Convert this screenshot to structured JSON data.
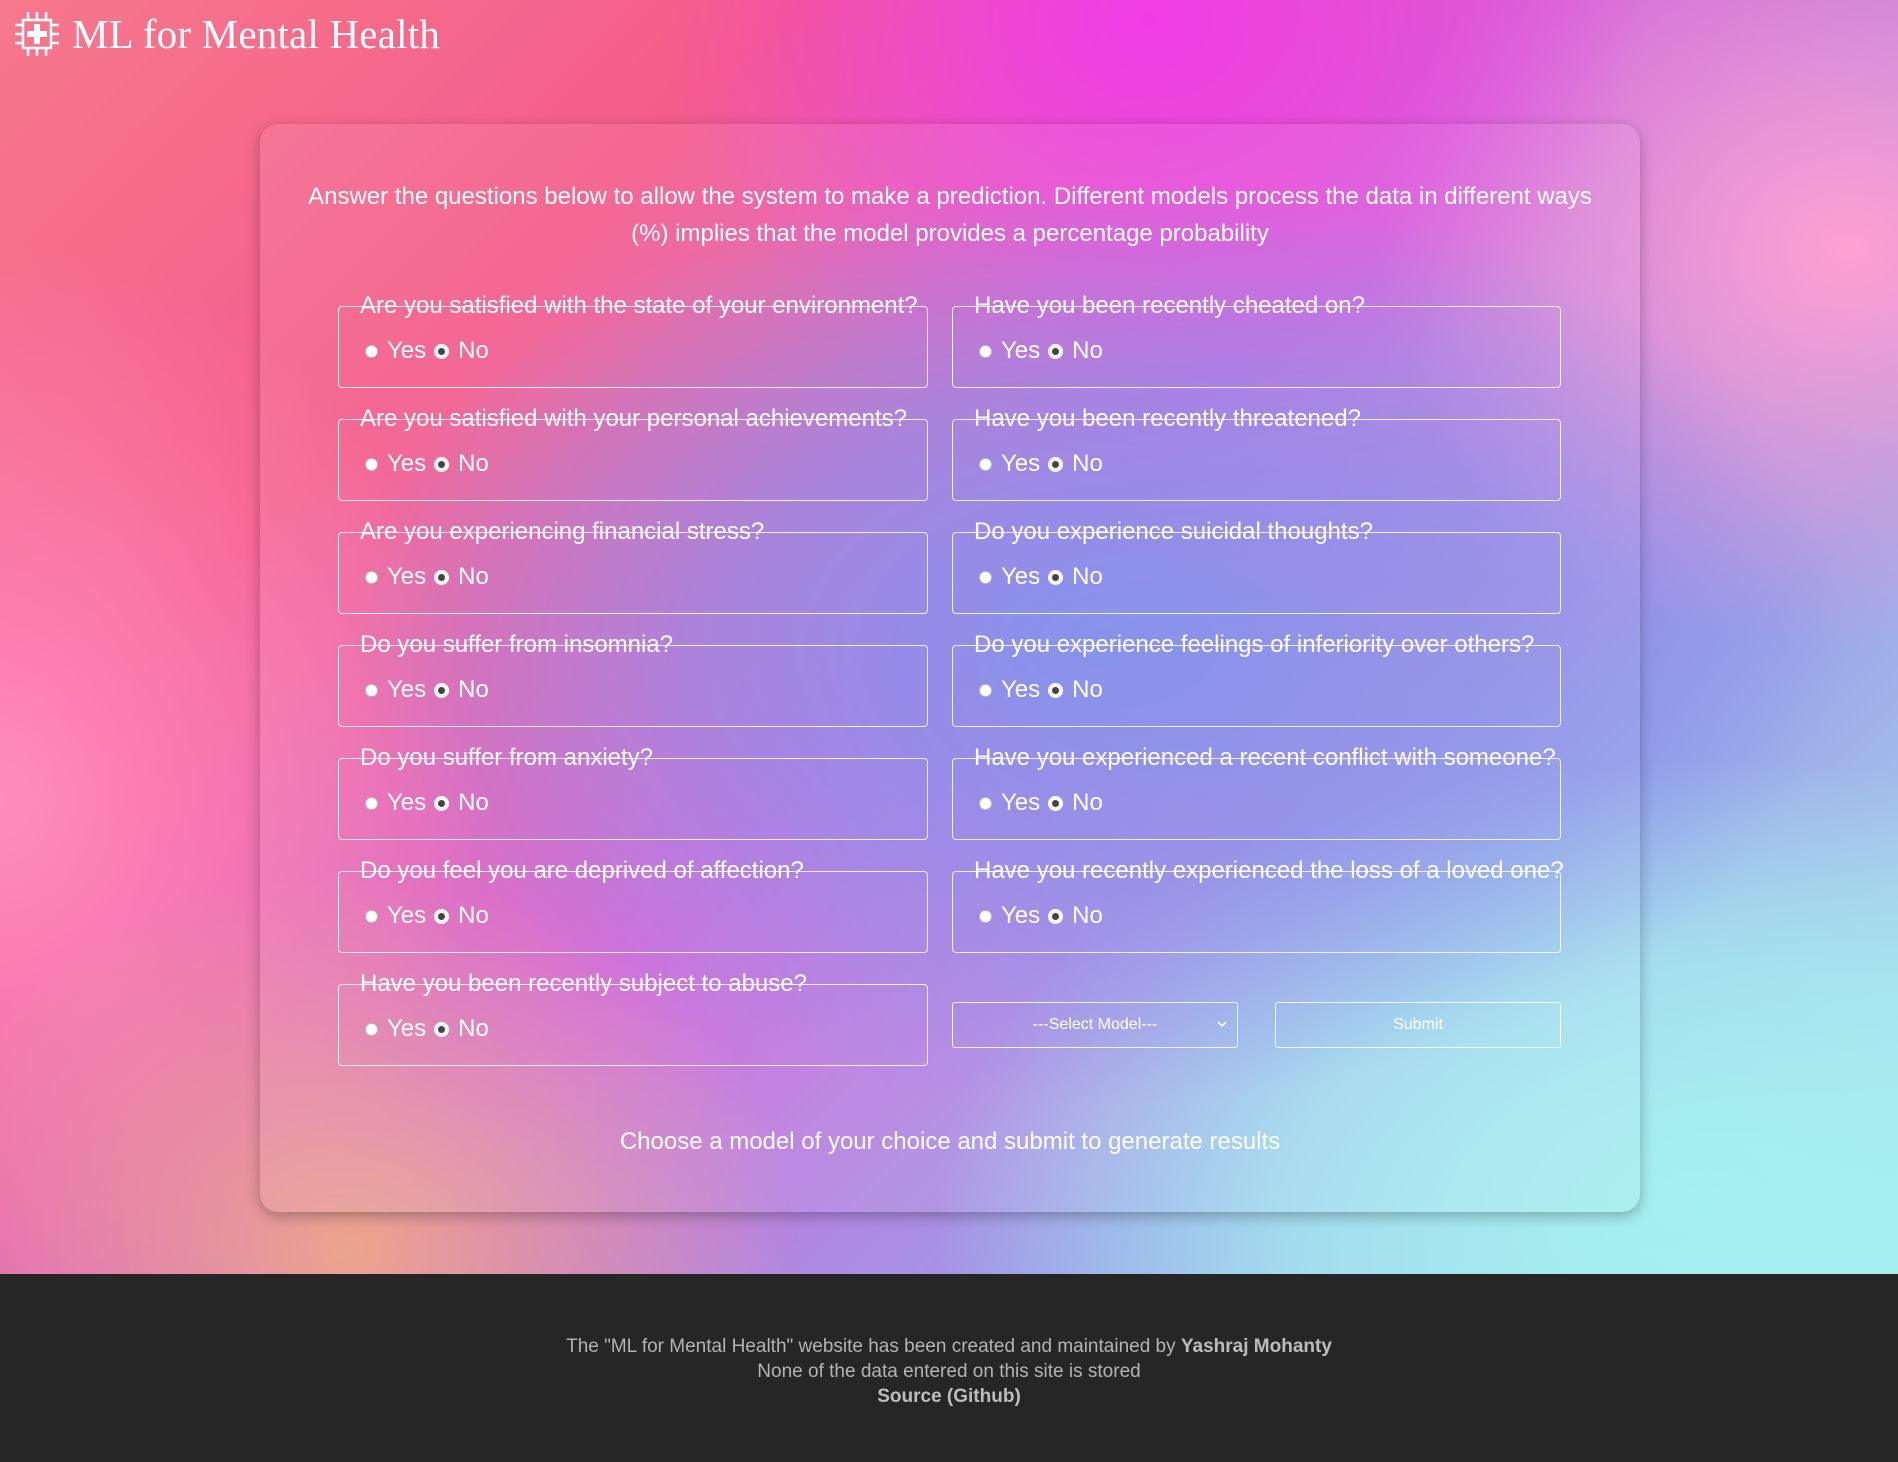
{
  "header": {
    "logo_icon": "medical-chip-icon",
    "title": "ML for Mental Health"
  },
  "intro": {
    "line1": "Answer the questions below to allow the system to make a prediction. Different models process the data in different ways",
    "line2": "(%) implies that the model provides a percentage probability"
  },
  "questions": [
    {
      "label": "Are you satisfied with the state of your environment?",
      "yes": "Yes",
      "no": "No",
      "selected": "No"
    },
    {
      "label": "Have you been recently cheated on?",
      "yes": "Yes",
      "no": "No",
      "selected": "No"
    },
    {
      "label": "Are you satisfied with your personal achievements?",
      "yes": "Yes",
      "no": "No",
      "selected": "No"
    },
    {
      "label": "Have you been recently threatened?",
      "yes": "Yes",
      "no": "No",
      "selected": "No"
    },
    {
      "label": "Are you experiencing financial stress?",
      "yes": "Yes",
      "no": "No",
      "selected": "No"
    },
    {
      "label": "Do you experience suicidal thoughts?",
      "yes": "Yes",
      "no": "No",
      "selected": "No"
    },
    {
      "label": "Do you suffer from insomnia?",
      "yes": "Yes",
      "no": "No",
      "selected": "No"
    },
    {
      "label": "Do you experience feelings of inferiority over others?",
      "yes": "Yes",
      "no": "No",
      "selected": "No"
    },
    {
      "label": "Do you suffer from anxiety?",
      "yes": "Yes",
      "no": "No",
      "selected": "No"
    },
    {
      "label": "Have you experienced a recent conflict with someone?",
      "yes": "Yes",
      "no": "No",
      "selected": "No"
    },
    {
      "label": "Do you feel you are deprived of affection?",
      "yes": "Yes",
      "no": "No",
      "selected": "No"
    },
    {
      "label": "Have you recently experienced the loss of a loved one?",
      "yes": "Yes",
      "no": "No",
      "selected": "No"
    },
    {
      "label": "Have you been recently subject to abuse?",
      "yes": "Yes",
      "no": "No",
      "selected": "No"
    }
  ],
  "controls": {
    "model_select_value": "---Select Model---",
    "submit_label": "Submit"
  },
  "result_message": "Choose a model of your choice and submit to generate results",
  "footer": {
    "credit_prefix": "The \"ML for Mental Health\" website has been created and maintained by",
    "author": "Yashraj Mohanty",
    "privacy": "None of the data entered on this site is stored",
    "source_link": "Source (Github)"
  }
}
